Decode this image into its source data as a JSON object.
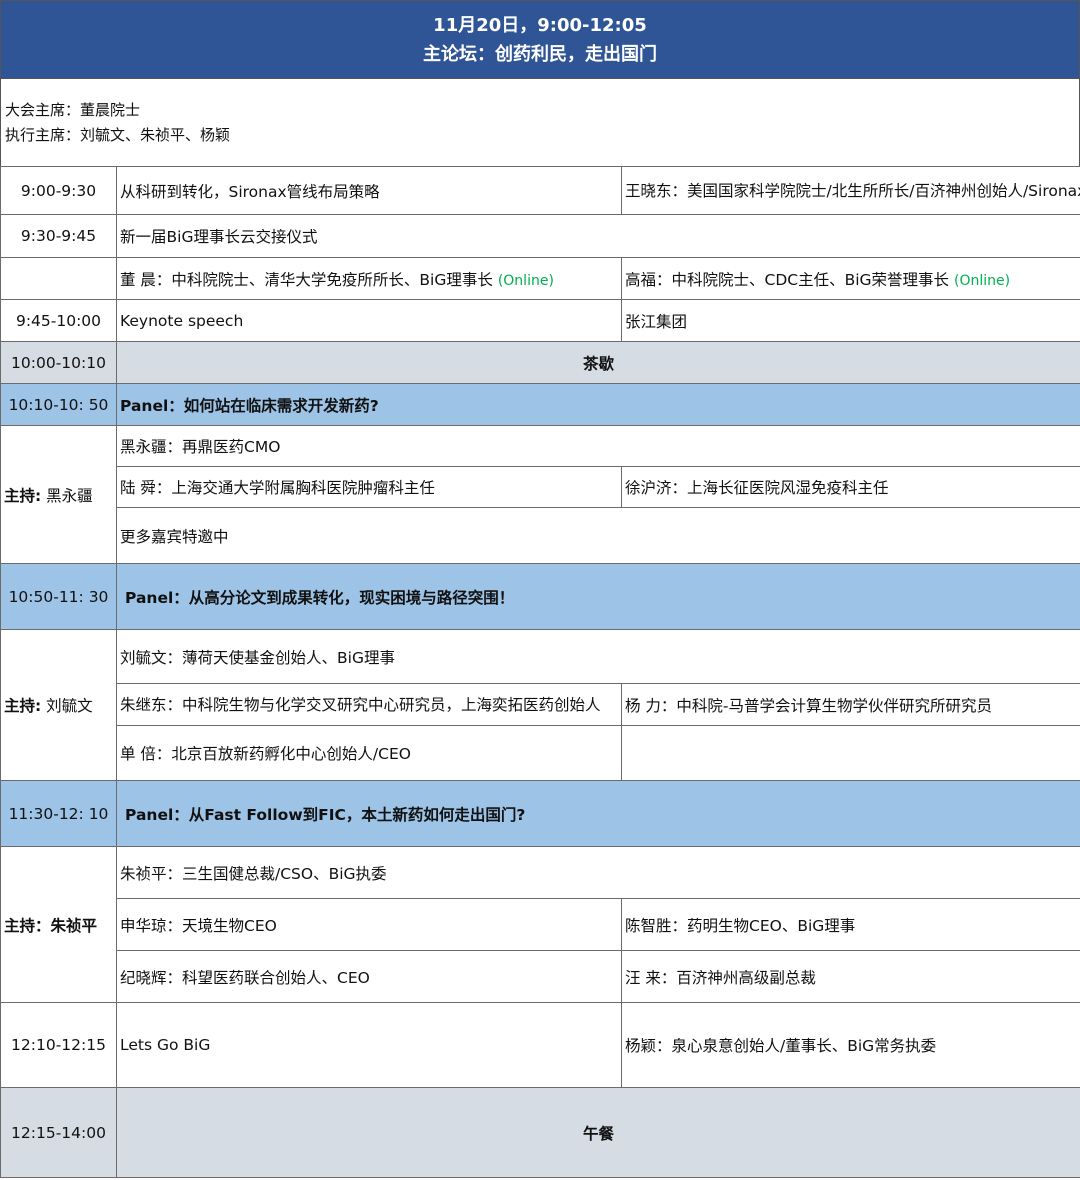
{
  "header": {
    "date_time": "11月20日，9:00-12:05",
    "forum_title": "主论坛：创药利民，走出国门"
  },
  "chairs": {
    "chair": "大会主席：董晨院士",
    "executive": "执行主席：刘毓文、朱祯平、杨颖"
  },
  "agenda": {
    "r1": {
      "time": "9:00-9:30",
      "topic": "从科研到转化，Sironax管线布局策略",
      "speaker": "王晓东：美国国家科学院院士/北生所所长/百济神州创始人/Sironax创始人、BiG理事"
    },
    "r2": {
      "time": "9:30-9:45",
      "topic": "新一届BiG理事长云交接仪式"
    },
    "r3": {
      "left": "董 晨：中科院院士、清华大学免疫所所长、BiG理事长",
      "left_tag": "(Online)",
      "right": "高福：中科院院士、CDC主任、BiG荣誉理事长",
      "right_tag": "(Online)"
    },
    "r4": {
      "time": "9:45-10:00",
      "topic": "Keynote speech",
      "speaker": "张江集团"
    },
    "r5": {
      "time": "10:00-10:10",
      "label": "茶歇"
    },
    "p1": {
      "time": "10:10-10: 50",
      "title": "Panel：如何站在临床需求开发新药?",
      "host_prefix": "主持:",
      "host_name": "黑永疆",
      "g1": "黑永疆：再鼎医药CMO",
      "g2": "陆 舜：上海交通大学附属胸科医院肿瘤科主任",
      "g3": "徐沪济：上海长征医院风湿免疫科主任",
      "g4": "更多嘉宾特邀中"
    },
    "p2": {
      "time": "10:50-11: 30",
      "title": "Panel：从高分论文到成果转化，现实困境与路径突围！",
      "host_prefix": "主持:",
      "host_name": "刘毓文",
      "g1": "刘毓文：薄荷天使基金创始人、BiG理事",
      "g2": "朱继东：中科院生物与化学交叉研究中心研究员，上海奕拓医药创始人",
      "g3": "杨 力：中科院-马普学会计算生物学伙伴研究所研究员",
      "g4": "单 倍：北京百放新药孵化中心创始人/CEO"
    },
    "p3": {
      "time": "11:30-12: 10",
      "title": "Panel：从Fast Follow到FIC，本土新药如何走出国门?",
      "host": "主持：朱祯平",
      "g1": "朱祯平：三生国健总裁/CSO、BiG执委",
      "g2": "申华琼：天境生物CEO",
      "g3": "陈智胜：药明生物CEO、BiG理事",
      "g4": "纪晓辉：科望医药联合创始人、CEO",
      "g5": "汪 来：百济神州高级副总裁"
    },
    "r6": {
      "time": "12:10-12:15",
      "topic": "Lets Go BiG",
      "speaker": "杨颖：泉心泉意创始人/董事长、BiG常务执委"
    },
    "r7": {
      "time": "12:15-14:00",
      "label": "午餐"
    }
  }
}
